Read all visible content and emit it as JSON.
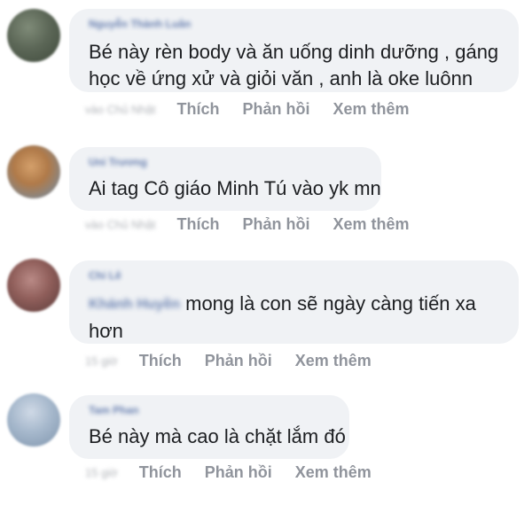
{
  "comments": [
    {
      "author": "Nguyễn Thành Luân",
      "text_lines": [
        "Bé này rèn body và ăn uống dinh dưỡng , gáng",
        "học về ứng xử và giỏi văn , anh là oke luônn"
      ],
      "time": "vào Chủ Nhật",
      "actions": {
        "like": "Thích",
        "reply": "Phản hồi",
        "more": "Xem thêm"
      }
    },
    {
      "author": "Uni Trương",
      "text_lines": [
        "Ai tag Cô giáo Minh Tú vào yk mn"
      ],
      "time": "vào Chủ Nhật",
      "actions": {
        "like": "Thích",
        "reply": "Phản hồi",
        "more": "Xem thêm"
      }
    },
    {
      "author": "Chi Lê",
      "mention": "Khánh Huyền",
      "text_lines": [
        "mong là con sẽ ngày càng tiến xa",
        "hơn"
      ],
      "time": "15 giờ",
      "actions": {
        "like": "Thích",
        "reply": "Phản hồi",
        "more": "Xem thêm"
      }
    },
    {
      "author": "Tam Phan",
      "text_lines": [
        "Bé này mà cao là chặt lắm đó"
      ],
      "time": "15 giờ",
      "actions": {
        "like": "Thích",
        "reply": "Phản hồi",
        "more": "Xem thêm"
      }
    }
  ]
}
